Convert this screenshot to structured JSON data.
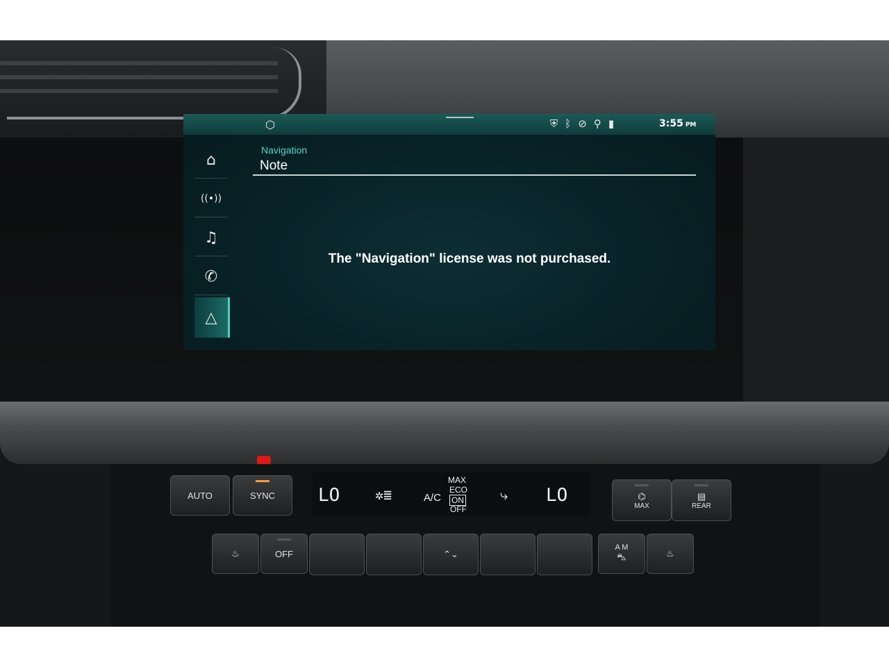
{
  "status_bar": {
    "time": "3:55",
    "am_pm": "PM",
    "icons": [
      "shield-icon",
      "bluetooth-icon",
      "mute-icon",
      "person-icon",
      "lte-icon"
    ]
  },
  "nav_rail": {
    "items": [
      {
        "name": "home",
        "icon": "⌂"
      },
      {
        "name": "radio",
        "icon": "((•))"
      },
      {
        "name": "music",
        "icon": "♫"
      },
      {
        "name": "phone",
        "icon": "✆"
      },
      {
        "name": "navigation",
        "icon": "△"
      }
    ]
  },
  "page": {
    "breadcrumb": "Navigation",
    "title": "Note",
    "message": "The \"Navigation\" license was not purchased."
  },
  "climate": {
    "auto_label": "AUTO",
    "sync_label": "SYNC",
    "left_temp": "LO",
    "right_temp": "LO",
    "ac_label": "A/C",
    "ac_modes": [
      "MAX",
      "ECO",
      "ON",
      "OFF"
    ],
    "max_label": "MAX",
    "rear_label": "REAR",
    "off_label": "OFF",
    "recirc_label": "A M"
  }
}
